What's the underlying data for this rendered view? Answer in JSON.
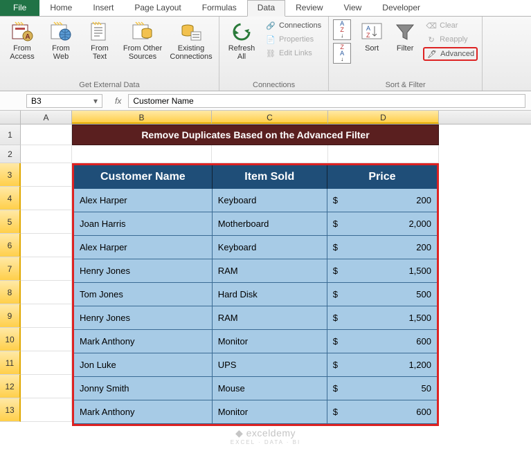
{
  "tabs": [
    "File",
    "Home",
    "Insert",
    "Page Layout",
    "Formulas",
    "Data",
    "Review",
    "View",
    "Developer"
  ],
  "active_tab": "Data",
  "ribbon": {
    "ext": {
      "access": "From\nAccess",
      "web": "From\nWeb",
      "text": "From\nText",
      "other": "From Other\nSources",
      "existing": "Existing\nConnections",
      "group": "Get External Data"
    },
    "conn": {
      "refresh": "Refresh\nAll",
      "connections": "Connections",
      "properties": "Properties",
      "editlinks": "Edit Links",
      "group": "Connections"
    },
    "sort": {
      "sort": "Sort",
      "filter": "Filter",
      "clear": "Clear",
      "reapply": "Reapply",
      "advanced": "Advanced",
      "group": "Sort & Filter"
    }
  },
  "namebox": "B3",
  "formula": "Customer Name",
  "cols": [
    "A",
    "B",
    "C",
    "D"
  ],
  "rownums": [
    "1",
    "2",
    "3",
    "4",
    "5",
    "6",
    "7",
    "8",
    "9",
    "10",
    "11",
    "12",
    "13"
  ],
  "title": "Remove Duplicates Based on the Advanced Filter",
  "headers": {
    "b": "Customer Name",
    "c": "Item Sold",
    "d": "Price"
  },
  "chart_data": {
    "type": "table",
    "columns": [
      "Customer Name",
      "Item Sold",
      "Price"
    ],
    "rows": [
      {
        "b": "Alex Harper",
        "c": "Keyboard",
        "cur": "$",
        "d": "200"
      },
      {
        "b": "Joan Harris",
        "c": "Motherboard",
        "cur": "$",
        "d": "2,000"
      },
      {
        "b": "Alex Harper",
        "c": "Keyboard",
        "cur": "$",
        "d": "200"
      },
      {
        "b": "Henry Jones",
        "c": "RAM",
        "cur": "$",
        "d": "1,500"
      },
      {
        "b": "Tom Jones",
        "c": "Hard Disk",
        "cur": "$",
        "d": "500"
      },
      {
        "b": "Henry Jones",
        "c": "RAM",
        "cur": "$",
        "d": "1,500"
      },
      {
        "b": "Mark Anthony",
        "c": "Monitor",
        "cur": "$",
        "d": "600"
      },
      {
        "b": "Jon Luke",
        "c": "UPS",
        "cur": "$",
        "d": "1,200"
      },
      {
        "b": "Jonny Smith",
        "c": "Mouse",
        "cur": "$",
        "d": "50"
      },
      {
        "b": "Mark Anthony",
        "c": "Monitor",
        "cur": "$",
        "d": "600"
      }
    ]
  },
  "watermark": {
    "brand": "exceldemy",
    "sub": "EXCEL · DATA · BI"
  }
}
